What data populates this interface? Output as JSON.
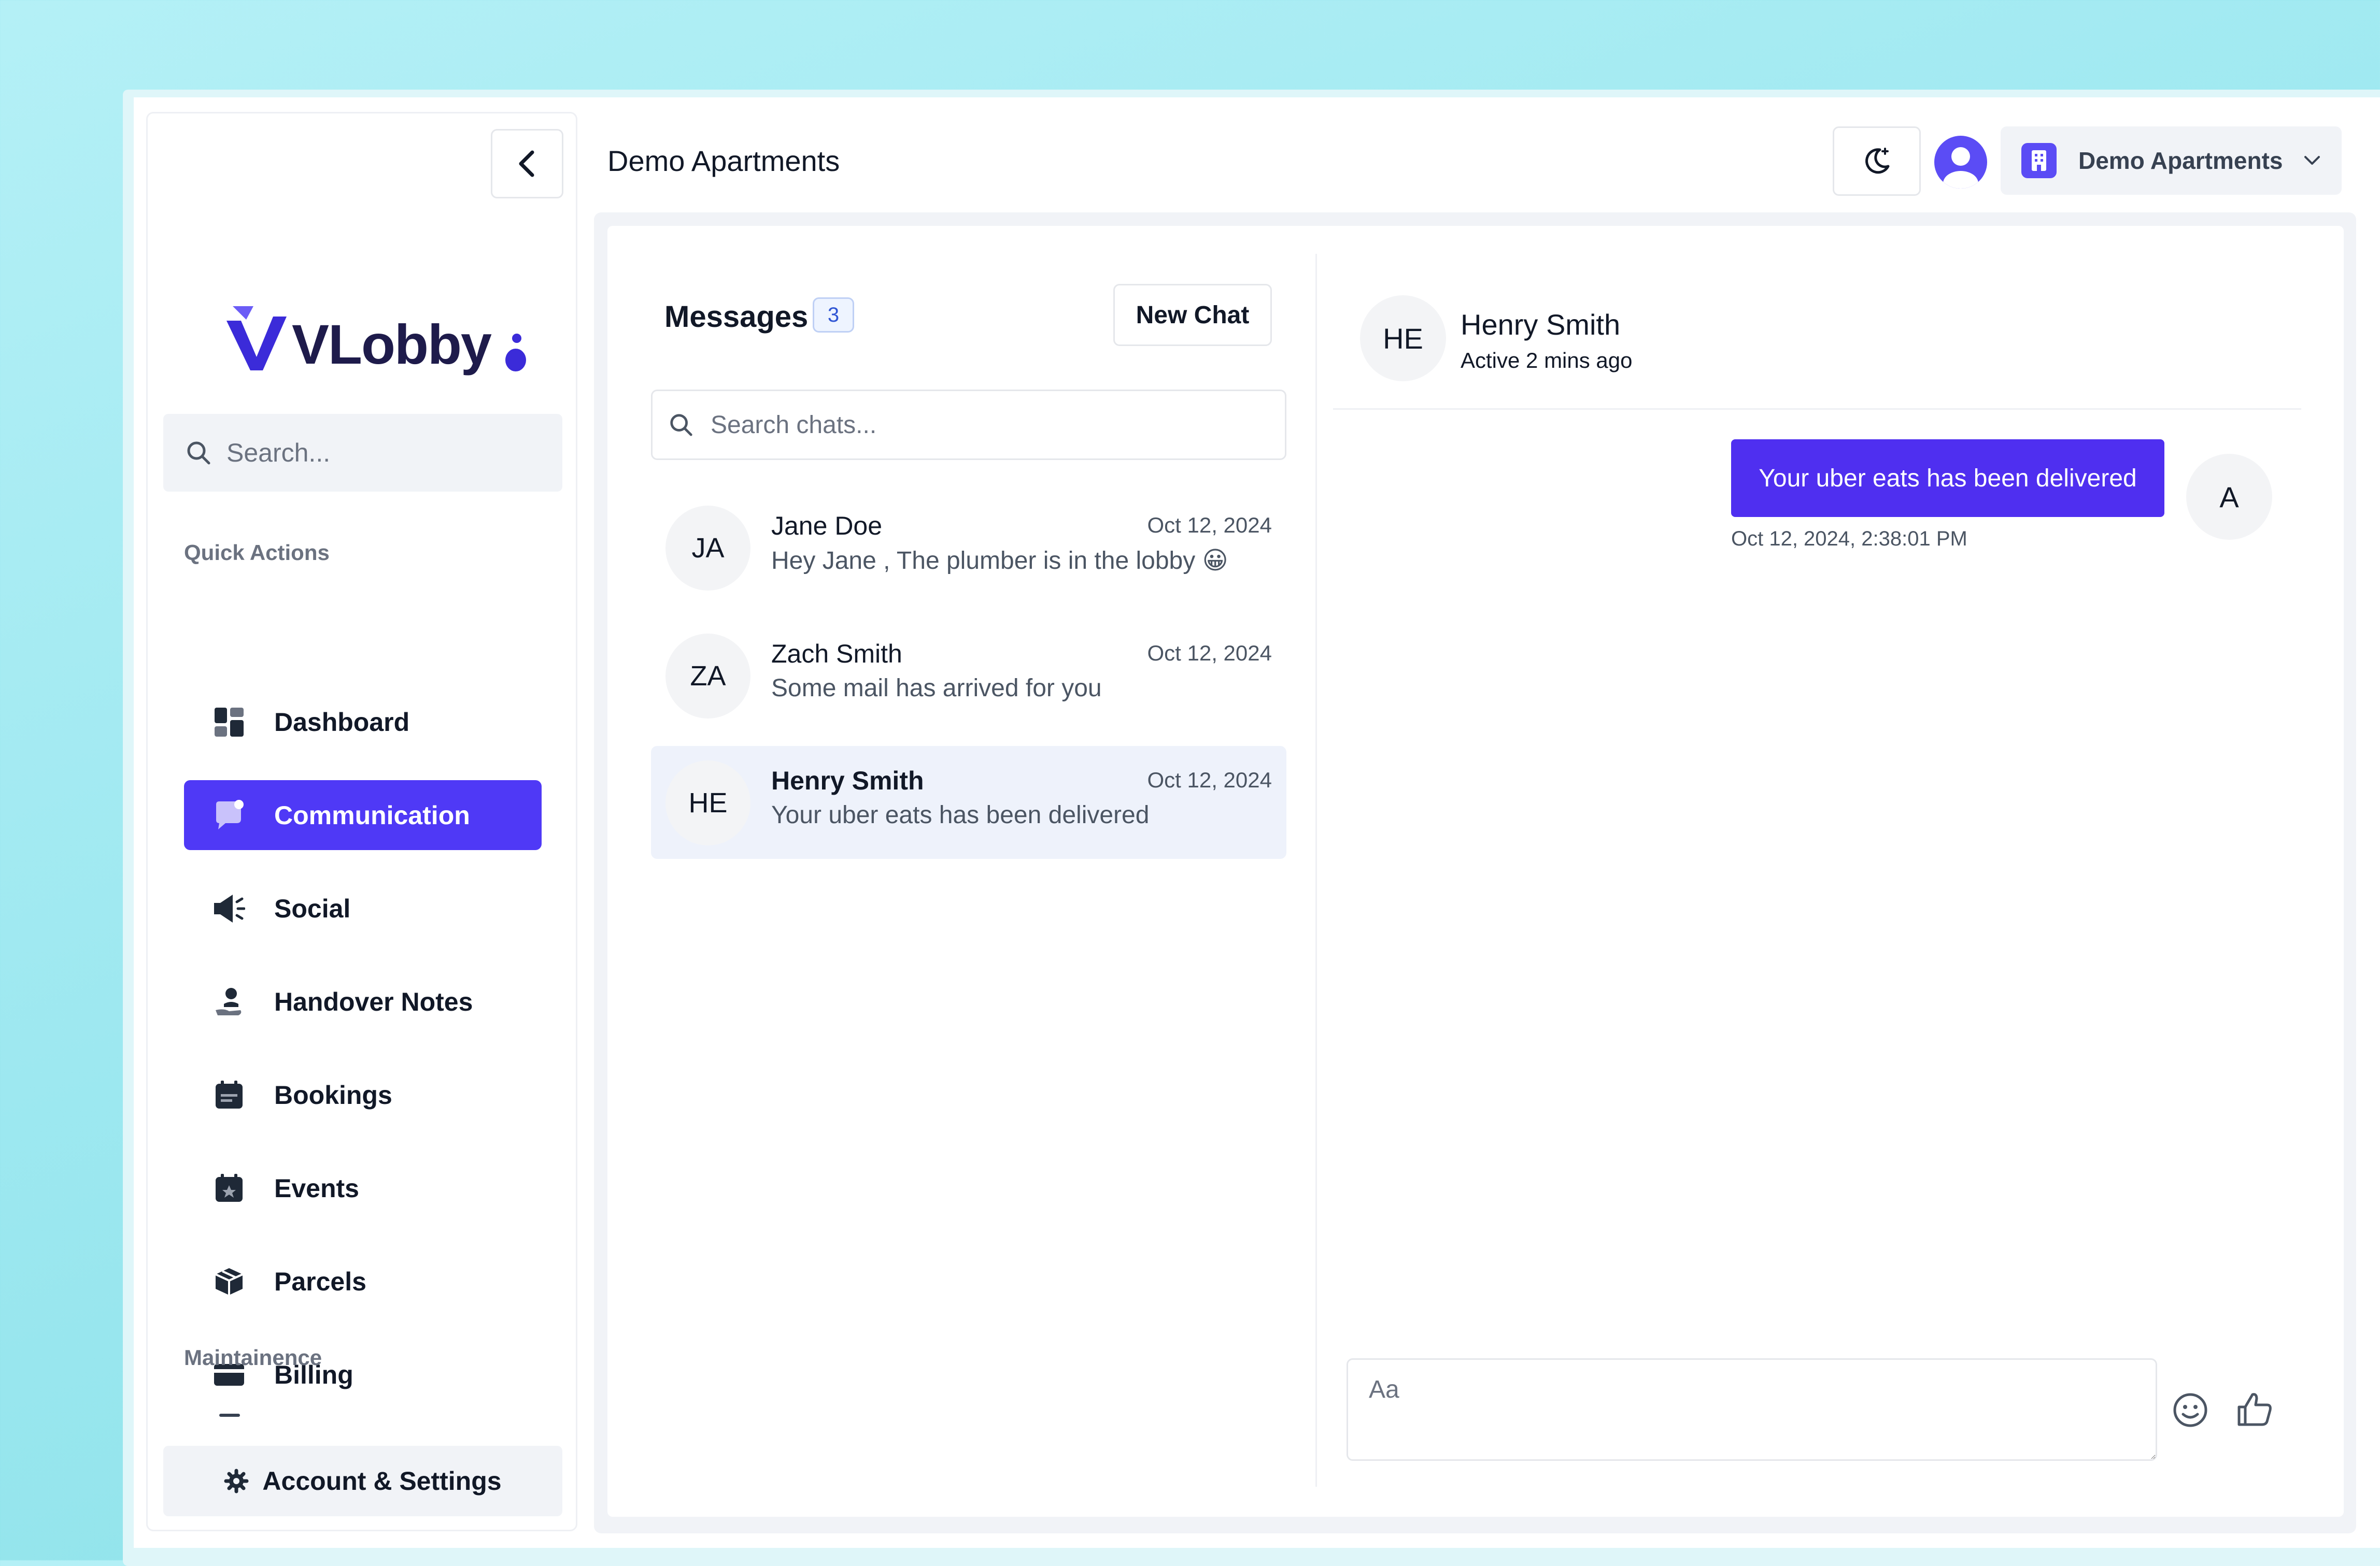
{
  "sidebar": {
    "logo_text": "VLobby",
    "search_placeholder": "Search...",
    "quick_actions_label": "Quick Actions",
    "items": [
      {
        "label": "Dashboard"
      },
      {
        "label": "Communication"
      },
      {
        "label": "Social"
      },
      {
        "label": "Handover Notes"
      },
      {
        "label": "Bookings"
      },
      {
        "label": "Events"
      },
      {
        "label": "Parcels"
      },
      {
        "label": "Billing"
      }
    ],
    "maintenance_label": "Maintainence",
    "account_label": "Account & Settings"
  },
  "header": {
    "title": "Demo Apartments",
    "org_selector": "Demo Apartments"
  },
  "messages": {
    "title": "Messages",
    "count": "3",
    "new_chat_label": "New Chat",
    "search_placeholder": "Search chats...",
    "chats": [
      {
        "initials": "JA",
        "name": "Jane Doe",
        "date": "Oct 12, 2024",
        "preview": "Hey Jane , The plumber is in the lobby 😀"
      },
      {
        "initials": "ZA",
        "name": "Zach Smith",
        "date": "Oct 12, 2024",
        "preview": "Some mail has arrived for you"
      },
      {
        "initials": "HE",
        "name": "Henry Smith",
        "date": "Oct 12, 2024",
        "preview": "Your uber eats has been delivered"
      }
    ]
  },
  "conversation": {
    "initials": "HE",
    "name": "Henry Smith",
    "status": "Active 2 mins ago",
    "message_text": "Your uber eats has been delivered",
    "message_time": "Oct 12, 2024, 2:38:01 PM",
    "sender_initial": "A",
    "composer_placeholder": "Aa"
  },
  "colors": {
    "accent": "#4f39f6",
    "bubble": "#4f2ff0",
    "badge_text": "#2f55d4"
  },
  "icons": {
    "collapse": "chevron-left-icon",
    "theme": "moon-icon",
    "org": "building-icon",
    "dropdown": "chevron-down-icon",
    "emoji": "smiley-icon",
    "like": "thumbs-up-icon"
  }
}
